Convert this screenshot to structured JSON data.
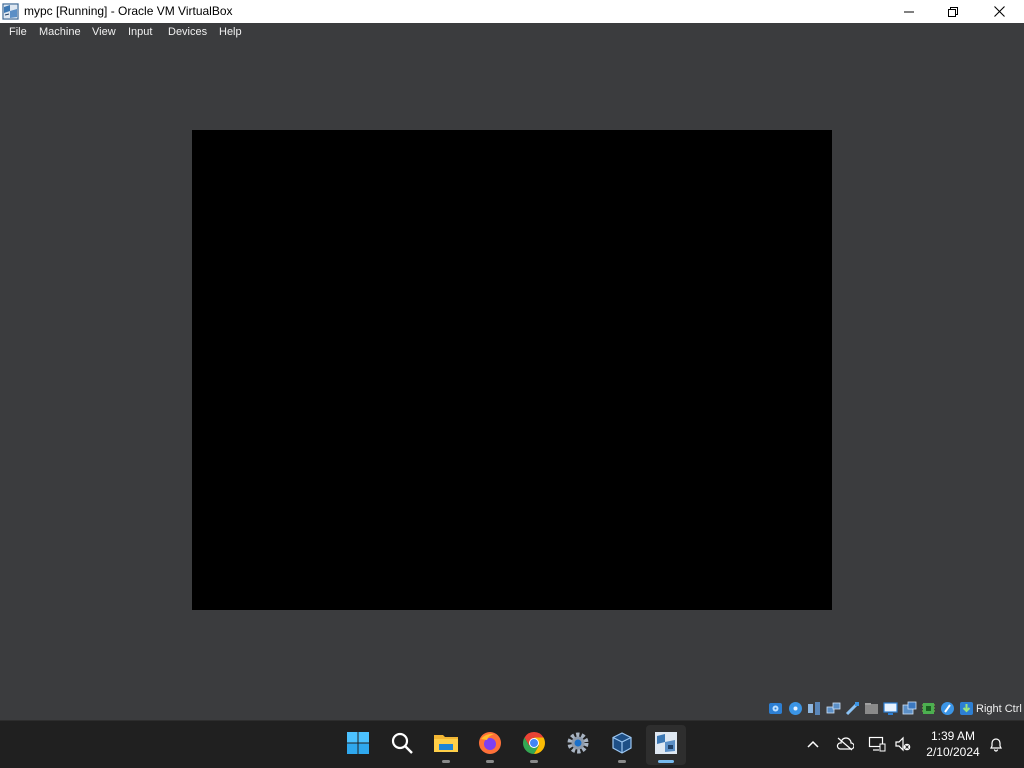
{
  "window": {
    "title": "mypc [Running] - Oracle VM VirtualBox",
    "icon": "virtualbox-icon"
  },
  "menu": {
    "items": [
      "File",
      "Machine",
      "View",
      "Input",
      "Devices",
      "Help"
    ]
  },
  "vm_screen": {
    "background": "#000000"
  },
  "statusbar": {
    "icons": [
      "hard-disk-icon",
      "optical-drive-icon",
      "audio-icon",
      "network-icon",
      "usb-icon",
      "shared-folders-icon",
      "display-icon",
      "recording-icon",
      "cpu-icon",
      "mouse-integration-icon",
      "host-key-icon"
    ],
    "host_key_label": "Right Ctrl"
  },
  "taskbar": {
    "apps": [
      "start-icon",
      "search-icon",
      "file-explorer-icon",
      "firefox-icon",
      "chrome-icon",
      "settings-icon",
      "virtualbox-manager-icon",
      "virtualbox-vm-icon"
    ],
    "tray": [
      "show-hidden-icons-chevron",
      "onedrive-icon",
      "network-icon",
      "volume-muted-icon",
      "notification-bell-icon"
    ],
    "time": "1:39 AM",
    "date": "2/10/2024"
  },
  "colors": {
    "background": "#3b3c3e",
    "taskbar": "#202020",
    "accent": "#76b9ed"
  }
}
